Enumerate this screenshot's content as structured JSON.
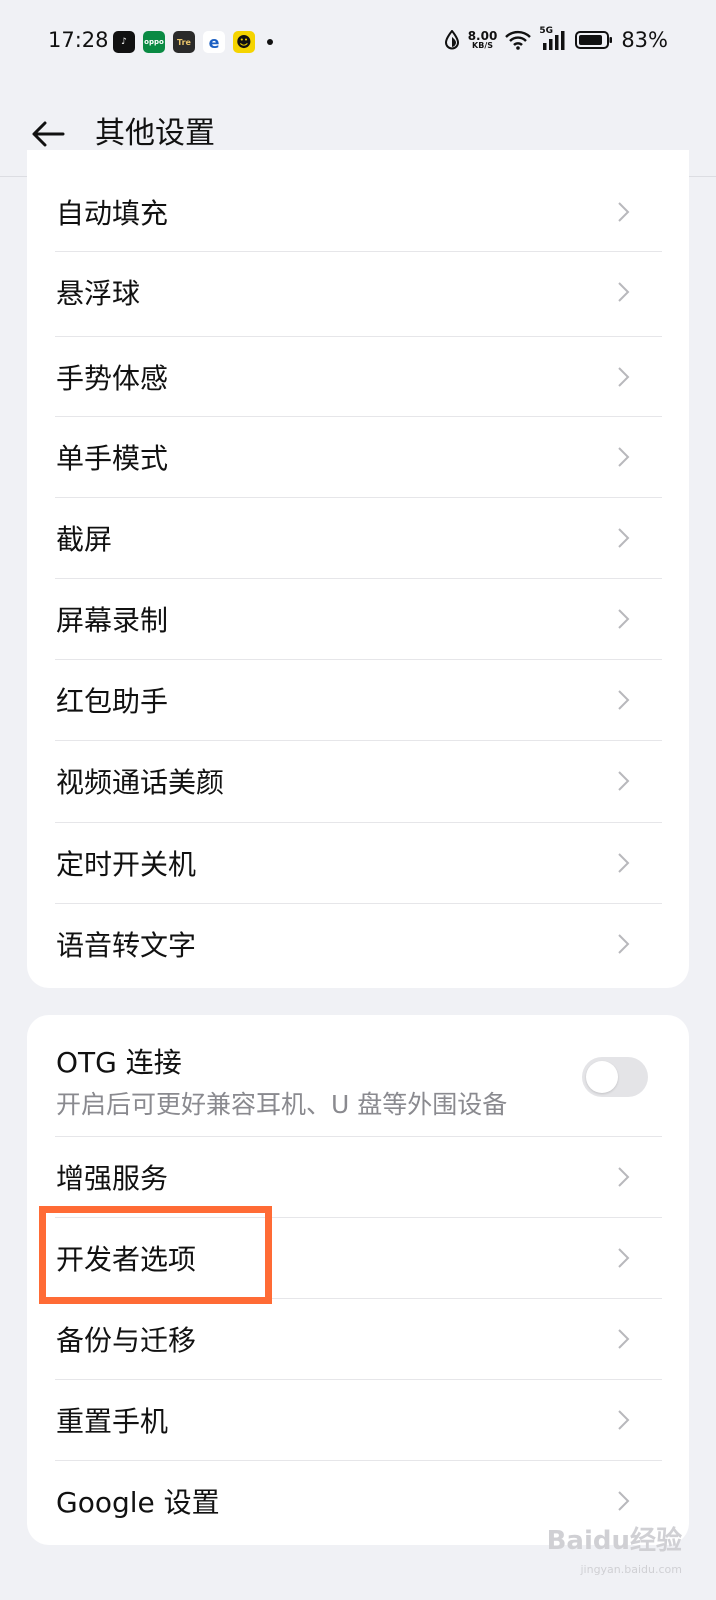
{
  "status_bar": {
    "time": "17:28",
    "app_icons": [
      {
        "name": "tiktok-icon",
        "bg": "#111111",
        "glyph": "♪"
      },
      {
        "name": "oppo-icon",
        "bg": "#0a8a43",
        "glyph": "oppo"
      },
      {
        "name": "tre-icon",
        "bg": "#2a2a2a",
        "glyph": "Tre"
      },
      {
        "name": "ie-icon",
        "bg": "#ffffff",
        "glyph": "e"
      },
      {
        "name": "avatar-app-icon",
        "bg": "#f5d400",
        "glyph": "☻"
      }
    ],
    "net_speed_value": "8.00",
    "net_speed_unit": "KB/S",
    "network": "5G",
    "battery_percent": "83%"
  },
  "header": {
    "title": "其他设置"
  },
  "group1": {
    "items": [
      {
        "label": "自动填充"
      },
      {
        "label": "悬浮球"
      },
      {
        "label": "手势体感"
      },
      {
        "label": "单手模式"
      },
      {
        "label": "截屏"
      },
      {
        "label": "屏幕录制"
      },
      {
        "label": "红包助手"
      },
      {
        "label": "视频通话美颜"
      },
      {
        "label": "定时开关机"
      },
      {
        "label": "语音转文字"
      }
    ]
  },
  "group2": {
    "otg": {
      "title": "OTG 连接",
      "subtitle": "开启后可更好兼容耳机、U 盘等外围设备",
      "enabled": false
    },
    "items": [
      {
        "label": "增强服务"
      },
      {
        "label": "开发者选项"
      },
      {
        "label": "备份与迁移"
      },
      {
        "label": "重置手机"
      },
      {
        "label": "Google 设置"
      }
    ]
  },
  "highlight_color": "#ff6b35",
  "watermark": {
    "text": "Baidu经验",
    "sub": "jingyan.baidu.com"
  }
}
